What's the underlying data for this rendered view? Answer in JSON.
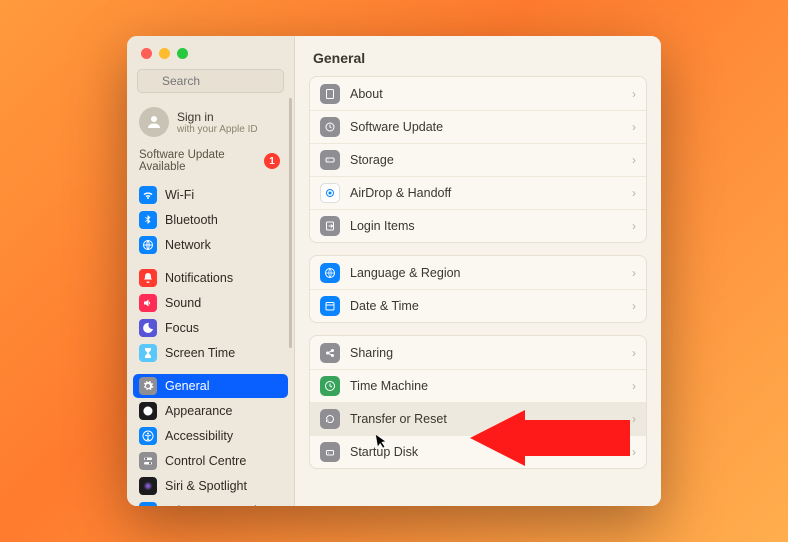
{
  "search": {
    "placeholder": "Search"
  },
  "account": {
    "title": "Sign in",
    "subtitle": "with your Apple ID"
  },
  "update": {
    "label": "Software Update Available",
    "count": "1"
  },
  "sidebar": {
    "items": [
      {
        "label": "Wi-Fi",
        "icon": "wifi",
        "bg": "#0a84ff"
      },
      {
        "label": "Bluetooth",
        "icon": "bluetooth",
        "bg": "#0a84ff"
      },
      {
        "label": "Network",
        "icon": "network",
        "bg": "#0a84ff"
      },
      {
        "label": "Notifications",
        "icon": "bell",
        "bg": "#ff3b30"
      },
      {
        "label": "Sound",
        "icon": "sound",
        "bg": "#ff2d55"
      },
      {
        "label": "Focus",
        "icon": "moon",
        "bg": "#5856d6"
      },
      {
        "label": "Screen Time",
        "icon": "hourglass",
        "bg": "#5ac8fa"
      },
      {
        "label": "General",
        "icon": "gear",
        "bg": "#8e8e93",
        "selected": true
      },
      {
        "label": "Appearance",
        "icon": "appearance",
        "bg": "#1c1c1e"
      },
      {
        "label": "Accessibility",
        "icon": "accessibility",
        "bg": "#0a84ff"
      },
      {
        "label": "Control Centre",
        "icon": "switches",
        "bg": "#8e8e93"
      },
      {
        "label": "Siri & Spotlight",
        "icon": "siri",
        "bg": "#1c1c1e"
      },
      {
        "label": "Privacy & Security",
        "icon": "hand",
        "bg": "#0a84ff"
      }
    ]
  },
  "header": {
    "title": "General"
  },
  "groups": [
    [
      {
        "label": "About",
        "icon": "about",
        "bg": "#8e8e93"
      },
      {
        "label": "Software Update",
        "icon": "update",
        "bg": "#8e8e93"
      },
      {
        "label": "Storage",
        "icon": "storage",
        "bg": "#8e8e93"
      },
      {
        "label": "AirDrop & Handoff",
        "icon": "airdrop",
        "bg": "#ffffff",
        "fg": "#0a84ff"
      },
      {
        "label": "Login Items",
        "icon": "login",
        "bg": "#8e8e93"
      }
    ],
    [
      {
        "label": "Language & Region",
        "icon": "globe",
        "bg": "#0a84ff"
      },
      {
        "label": "Date & Time",
        "icon": "calendar",
        "bg": "#0a84ff"
      }
    ],
    [
      {
        "label": "Sharing",
        "icon": "sharing",
        "bg": "#8e8e93"
      },
      {
        "label": "Time Machine",
        "icon": "timemachine",
        "bg": "#37a35b"
      },
      {
        "label": "Transfer or Reset",
        "icon": "reset",
        "bg": "#8e8e93",
        "hover": true
      },
      {
        "label": "Startup Disk",
        "icon": "disk",
        "bg": "#8e8e93"
      }
    ]
  ]
}
